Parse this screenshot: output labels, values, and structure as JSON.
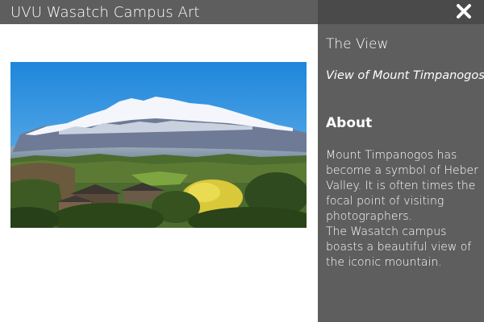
{
  "header": {
    "title": "UVU Wasatch Campus Art"
  },
  "panel": {
    "title": "The View",
    "caption": "View of Mount Timpanogos",
    "about_heading": "About",
    "about_paragraphs": [
      "Mount Timpanogos has become a symbol of Heber Valley. It is often times the focal point of visiting photographers.",
      "The Wasatch campus boasts a beautiful view of the iconic mountain."
    ],
    "close_icon": "close-icon"
  },
  "image": {
    "subject": "mountain-landscape"
  },
  "colors": {
    "header_bg": "#5e5e5e",
    "panel_bg": "#5e5e5e",
    "panel_top_bg": "#4a4a4a",
    "text": "#ffffff"
  }
}
